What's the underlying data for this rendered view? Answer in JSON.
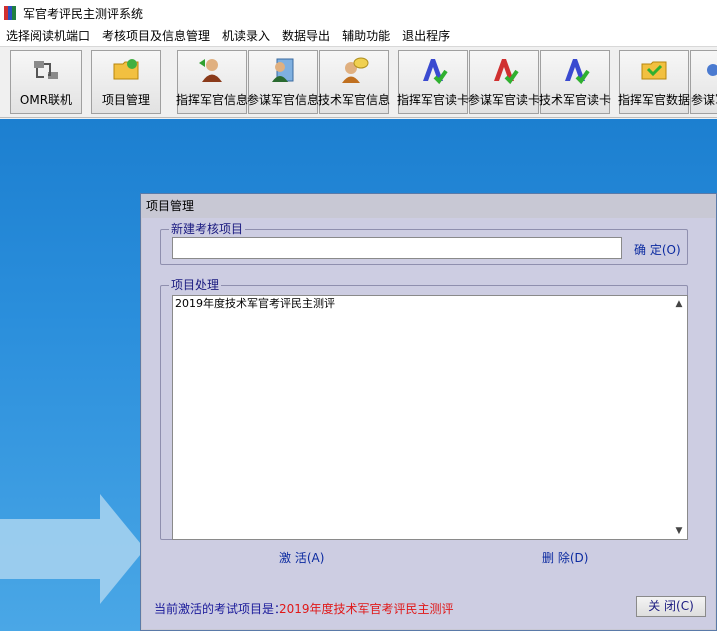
{
  "window": {
    "title": "军官考评民主测评系统"
  },
  "menu": [
    "选择阅读机端口",
    "考核项目及信息管理",
    "机读录入",
    "数据导出",
    "辅助功能",
    "退出程序"
  ],
  "toolbar": [
    {
      "label": "OMR联机",
      "icon": "omr-connect-icon"
    },
    {
      "label": "项目管理",
      "icon": "folder-project-icon"
    },
    {
      "label": "指挥军官信息",
      "icon": "commander-person-icon"
    },
    {
      "label": "参谋军官信息",
      "icon": "staff-person-icon"
    },
    {
      "label": "技术军官信息",
      "icon": "tech-person-icon"
    },
    {
      "label": "指挥军官读卡",
      "icon": "commander-read-card-icon"
    },
    {
      "label": "参谋军官读卡",
      "icon": "staff-read-card-icon"
    },
    {
      "label": "技术军官读卡",
      "icon": "tech-read-card-icon"
    },
    {
      "label": "指挥军官数据",
      "icon": "commander-data-icon"
    },
    {
      "label": "参谋军",
      "icon": "staff-data-icon"
    }
  ],
  "dialog": {
    "title": "项目管理",
    "new_project": {
      "legend": "新建考核项目",
      "input_value": "",
      "confirm_label": "确 定(O)"
    },
    "project_handling": {
      "legend": "项目处理",
      "items": [
        "2019年度技术军官考评民主测评"
      ],
      "activate_label": "激 活(A)",
      "delete_label": "删 除(D)"
    },
    "status": {
      "label": "当前激活的考试项目是：",
      "value": "2019年度技术军官考评民主测评"
    },
    "close_label": "关 闭(C)"
  },
  "colors": {
    "desktop": "#2b8fdc",
    "status_value": "#e01818",
    "accent_text": "#1a1a80"
  }
}
